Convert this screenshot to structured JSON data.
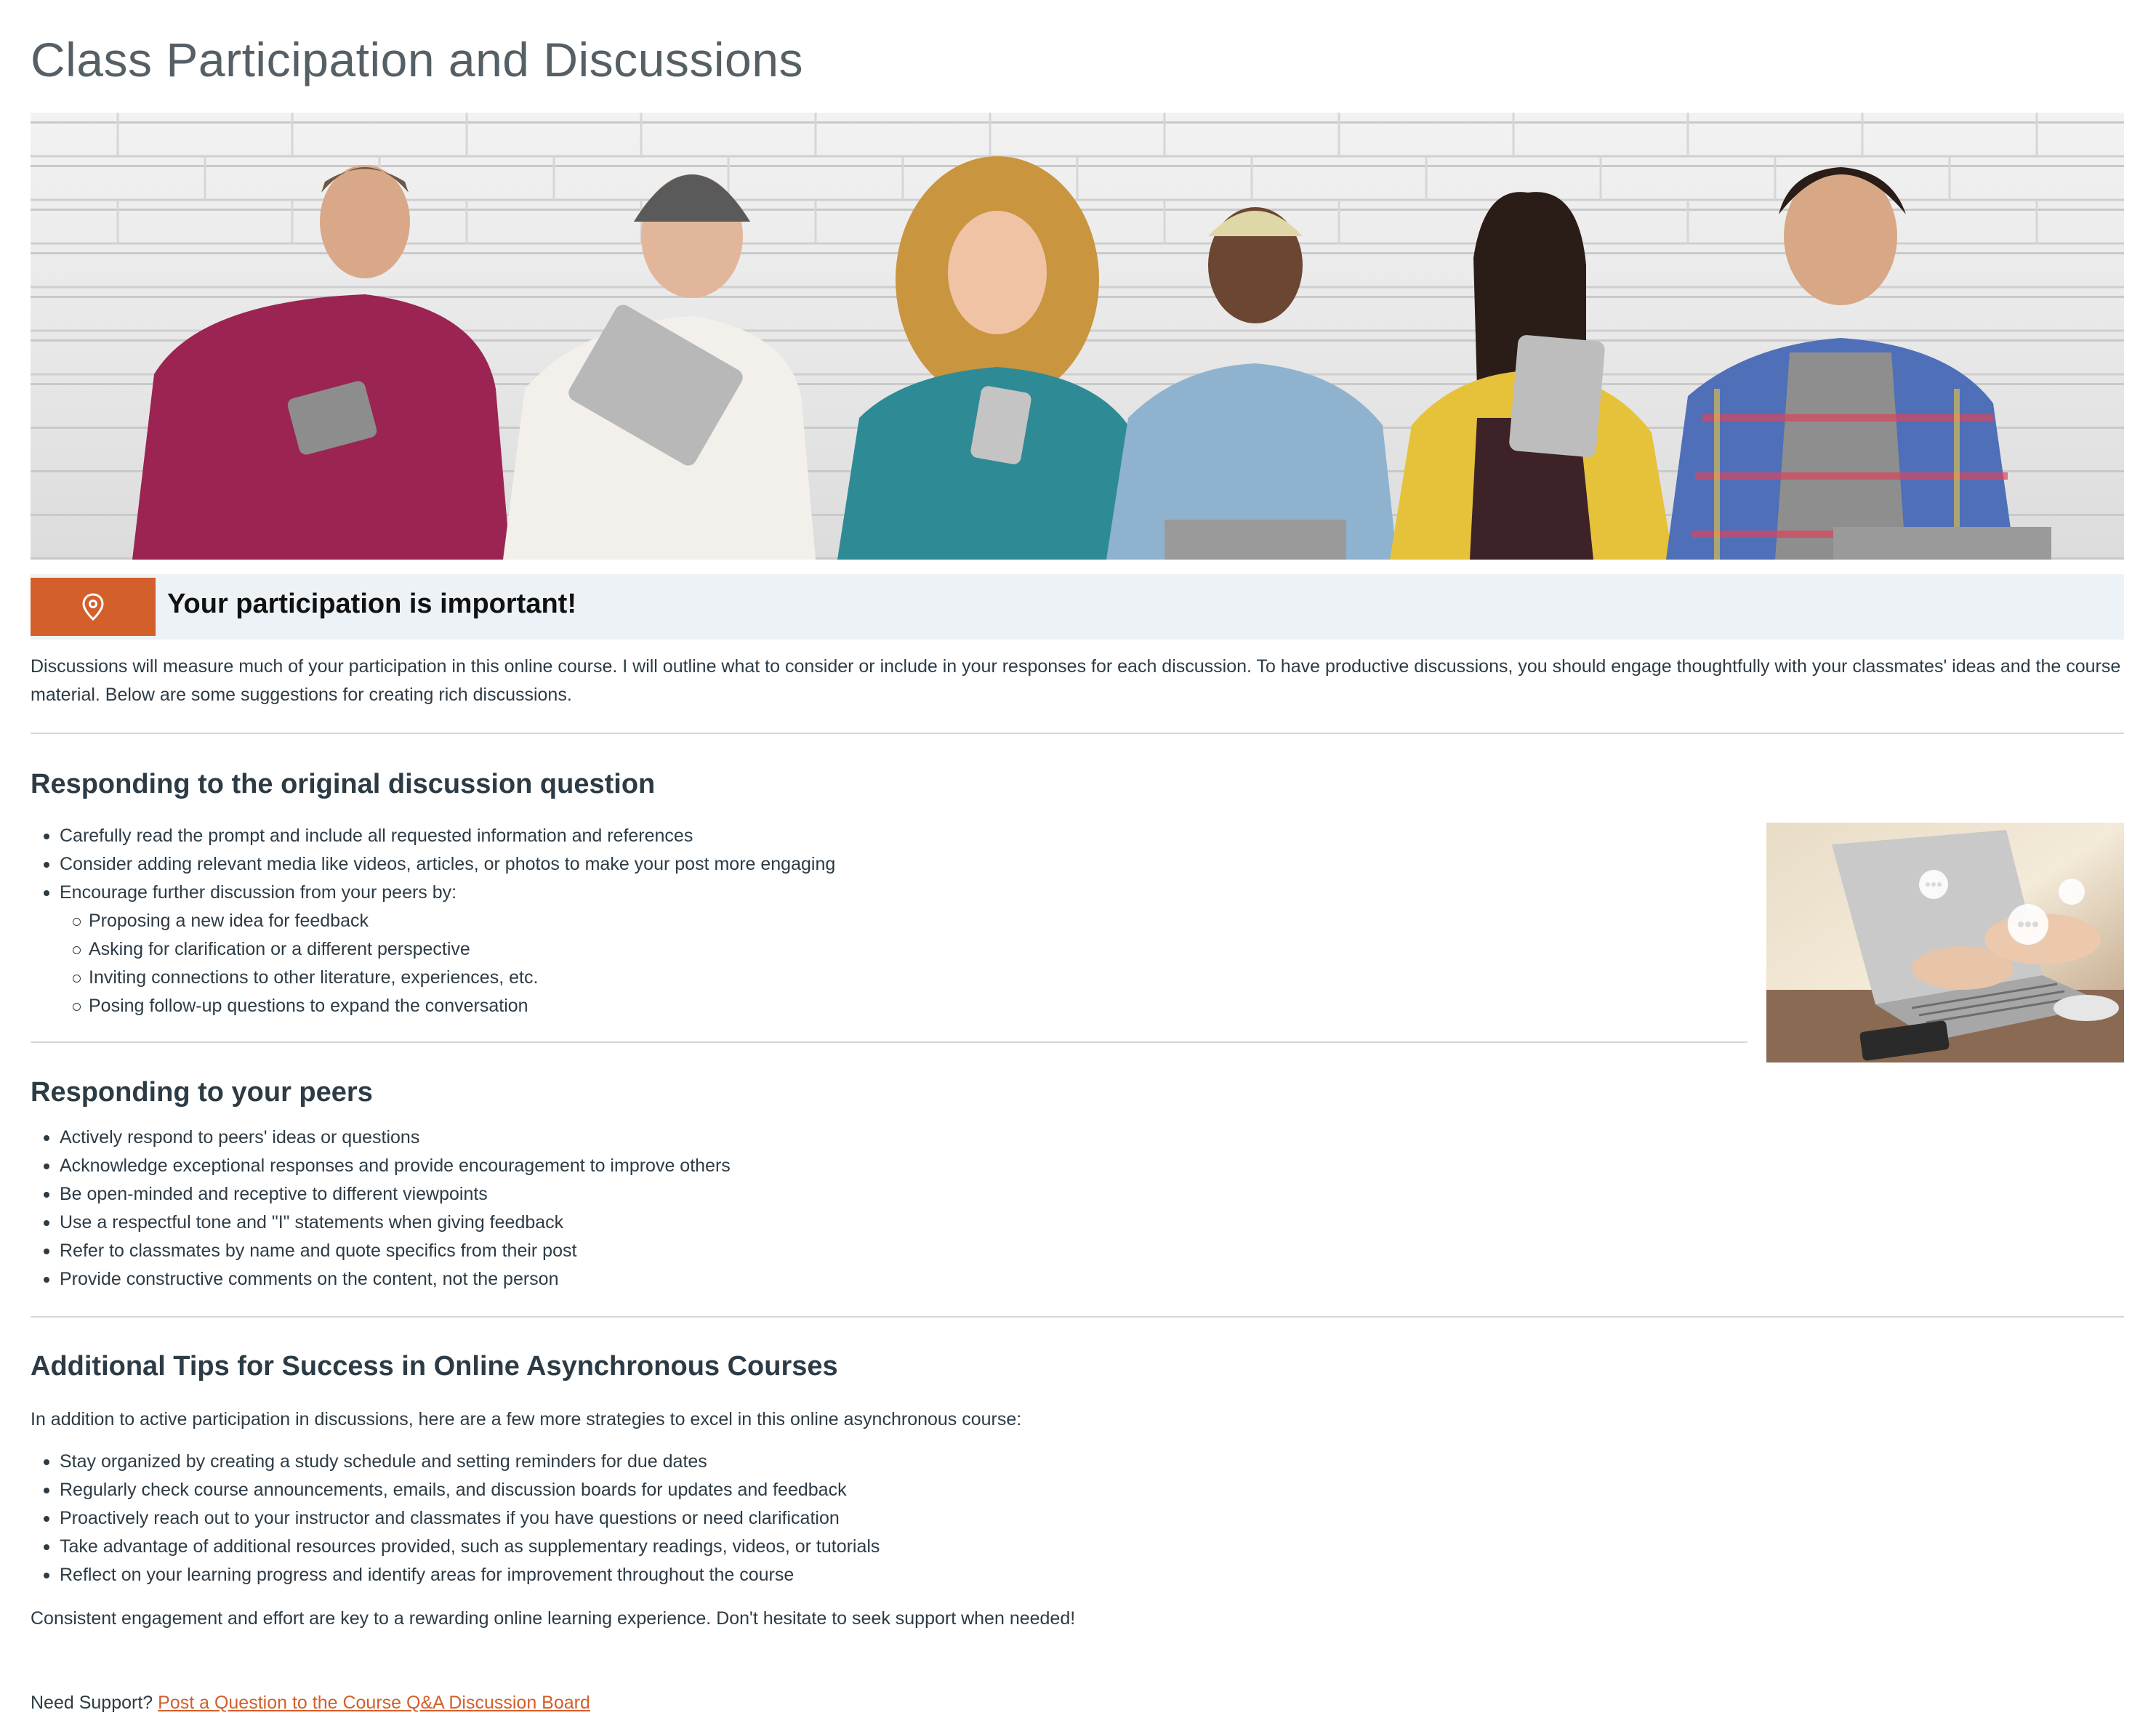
{
  "page": {
    "title": "Class Participation and Discussions"
  },
  "banner": {
    "icon": "banner-photo"
  },
  "callout": {
    "icon": "map-pin-icon",
    "title": "Your participation is important!",
    "accent_color": "#d35f2b",
    "background_color": "#edf2f6"
  },
  "intro": {
    "text": "Discussions will measure much of your participation in this online course. I will outline what to consider or include in your responses for each discussion. To have productive discussions, you should engage thoughtfully with your classmates' ideas and the course material. Below are some suggestions for creating rich discussions."
  },
  "section1": {
    "heading": "Responding to the original discussion question",
    "items": [
      "Carefully read the prompt and include all requested information and references",
      "Consider adding relevant media like videos, articles, or photos to make your post more engaging",
      "Encourage further discussion from your peers by:"
    ],
    "subitems": [
      "Proposing a new idea for feedback",
      "Asking for clarification or a different perspective",
      "Inviting connections to other literature, experiences, etc.",
      "Posing follow-up questions to expand the conversation"
    ]
  },
  "section2": {
    "heading": "Responding to your peers",
    "items": [
      "Actively respond to peers' ideas or questions",
      "Acknowledge exceptional responses and provide encouragement to improve others",
      "Be open-minded and receptive to different viewpoints",
      "Use a respectful tone and \"I\" statements when giving feedback",
      "Refer to classmates by name and quote specifics from their post",
      "Provide constructive comments on the content, not the person"
    ]
  },
  "section3": {
    "heading": "Additional Tips for Success in Online Asynchronous Courses",
    "intro": "In addition to active participation in discussions, here are a few more strategies to excel in this online asynchronous course:",
    "items": [
      "Stay organized by creating a study schedule and setting reminders for due dates",
      "Regularly check course announcements, emails, and discussion boards for updates and feedback",
      "Proactively reach out to your instructor and classmates if you have questions or need clarification",
      "Take advantage of additional resources provided, such as supplementary readings, videos, or tutorials",
      "Reflect on your learning progress and identify areas for improvement throughout the course"
    ],
    "closing": "Consistent engagement and effort are key to a rewarding online learning experience. Don't hesitate to seek support when needed!"
  },
  "support": {
    "prefix": "Need Support?",
    "link_text": "Post a Question to the Course Q&A Discussion Board",
    "link_color": "#d35f2b"
  }
}
